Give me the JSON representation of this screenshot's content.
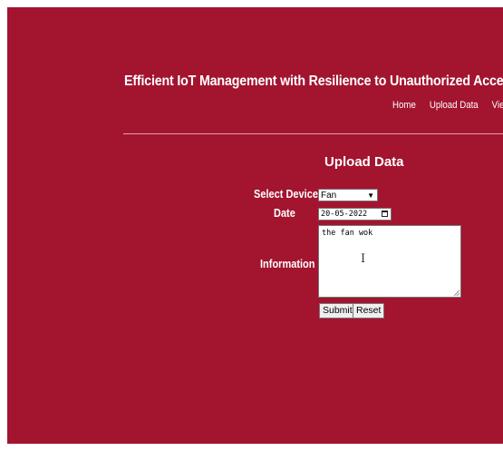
{
  "header": {
    "site_title": "Efficient IoT Management with Resilience to Unauthorized Access to Cl"
  },
  "nav": {
    "items": [
      {
        "label": "Home"
      },
      {
        "label": "Upload Data"
      },
      {
        "label": "Vie"
      }
    ]
  },
  "main": {
    "heading": "Upload Data",
    "form": {
      "device_label": "Select Device",
      "device_value": "Fan",
      "date_label": "Date",
      "date_value": "20-05-2022",
      "info_label": "Information",
      "info_value": "the fan wok",
      "submit_label": "Submit",
      "reset_label": "Reset"
    }
  },
  "colors": {
    "background": "#a3142f",
    "text": "#ffffff"
  }
}
